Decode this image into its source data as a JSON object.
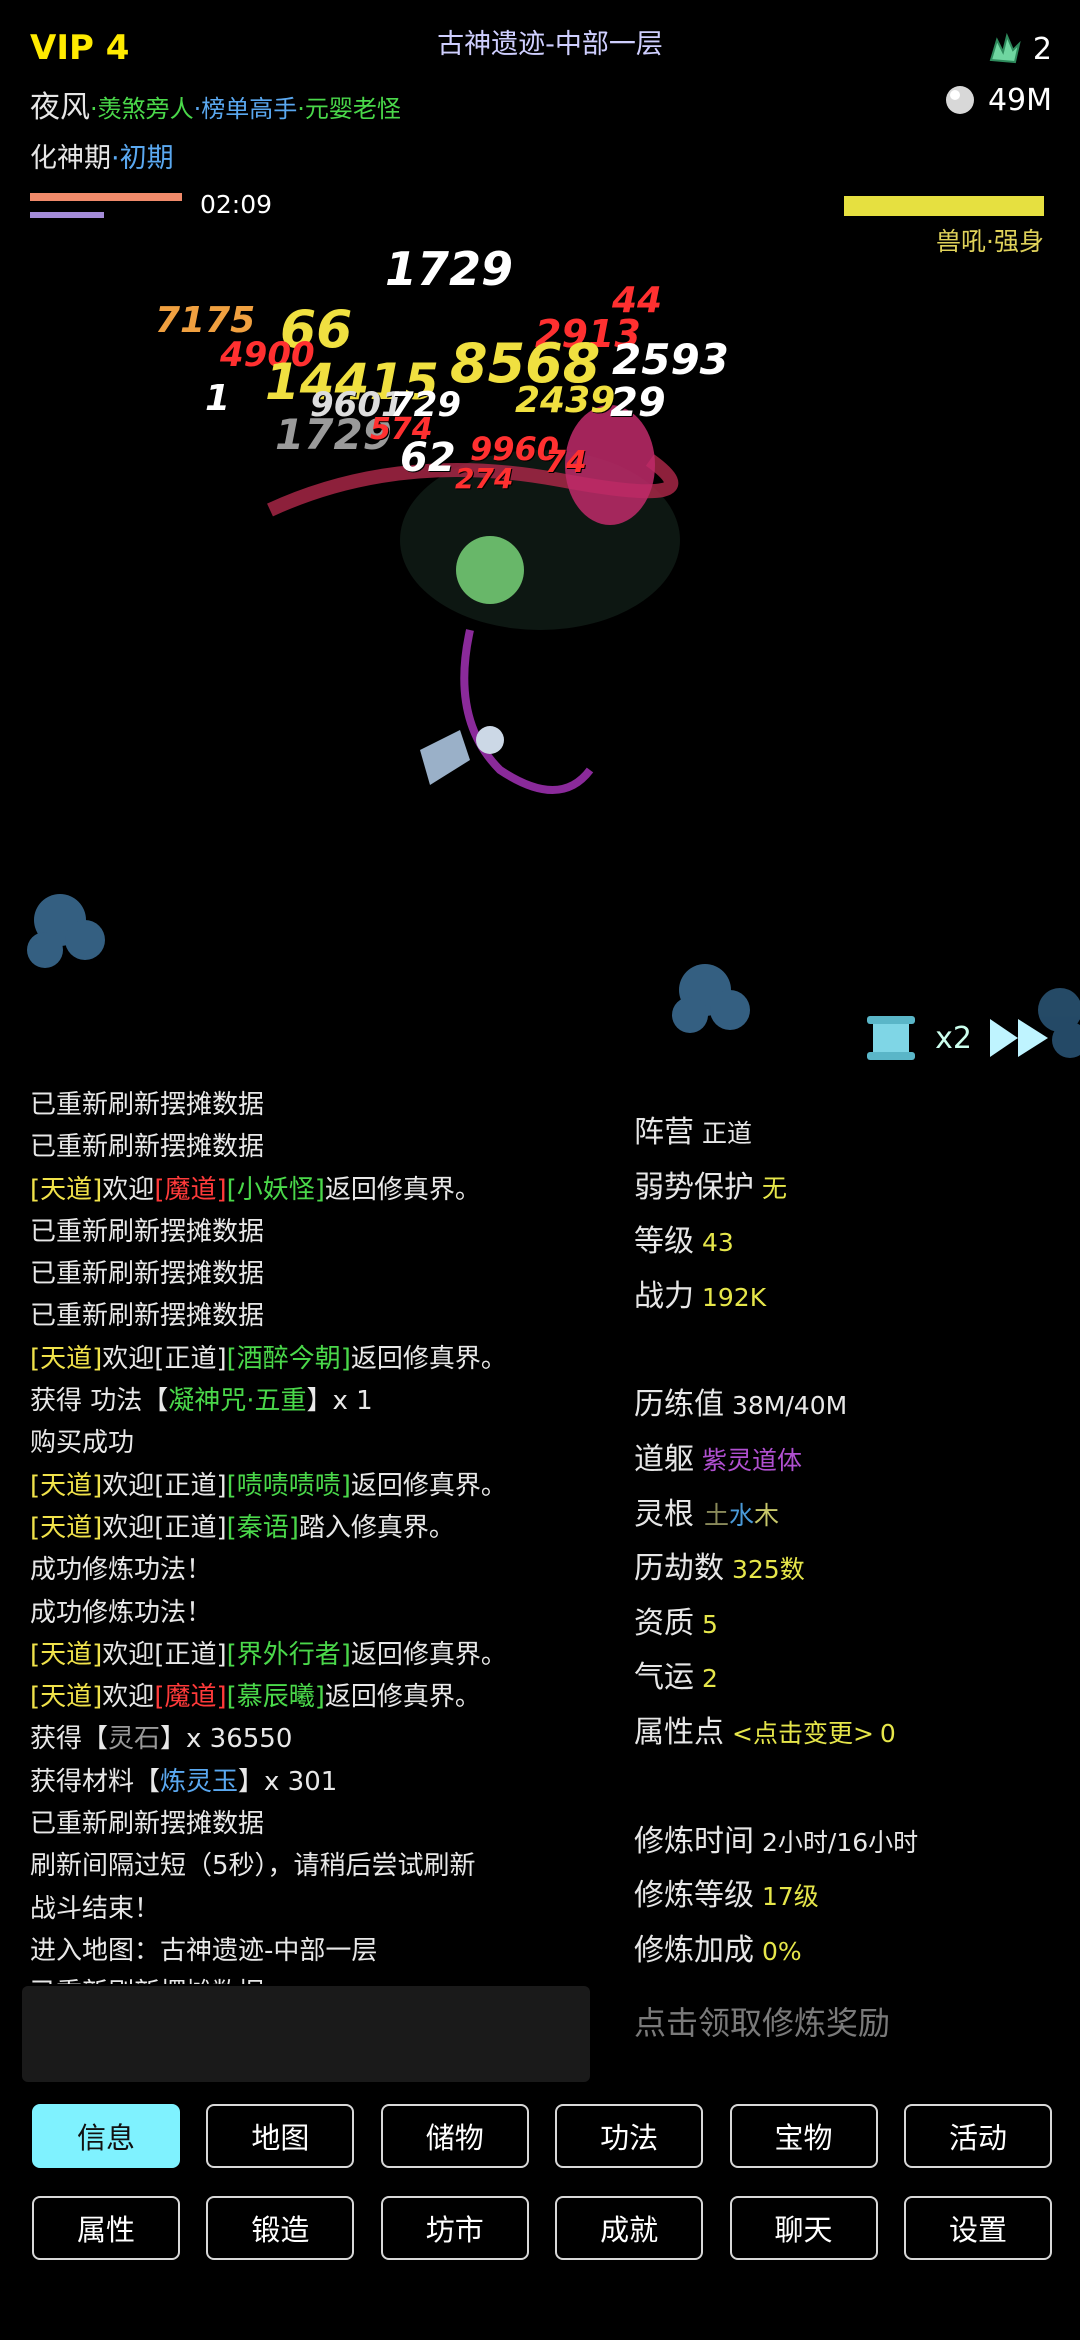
{
  "header": {
    "vip": "VIP 4",
    "map_title": "古神遗迹-中部一层",
    "gems": "2",
    "silver": "49M",
    "player_name": "夜风",
    "titles": [
      "·羡煞旁人",
      "·榜单高手",
      "·元婴老怪"
    ],
    "realm": "化神期",
    "realm_stage": "·初期",
    "timer": "02:09",
    "enemy_name": "兽吼·强身",
    "speed": "x2"
  },
  "damage_numbers": [
    "1729",
    "44",
    "7175",
    "66",
    "2913",
    "4900",
    "8568",
    "2593",
    "14415",
    "1",
    "9601",
    "729",
    "2439",
    "29",
    "1729",
    "574",
    "9960",
    "62",
    "274",
    "74"
  ],
  "log": [
    {
      "parts": [
        {
          "t": "已重新刷新摆摊数据"
        }
      ]
    },
    {
      "parts": [
        {
          "t": "已重新刷新摆摊数据"
        }
      ]
    },
    {
      "parts": [
        {
          "t": "[天道]",
          "c": "tian"
        },
        {
          "t": "欢迎"
        },
        {
          "t": "[魔道]",
          "c": "mo"
        },
        {
          "t": "[小妖怪]",
          "c": "name"
        },
        {
          "t": "返回修真界。"
        }
      ]
    },
    {
      "parts": [
        {
          "t": "已重新刷新摆摊数据"
        }
      ]
    },
    {
      "parts": [
        {
          "t": "已重新刷新摆摊数据"
        }
      ]
    },
    {
      "parts": [
        {
          "t": "已重新刷新摆摊数据"
        }
      ]
    },
    {
      "parts": [
        {
          "t": "[天道]",
          "c": "tian"
        },
        {
          "t": "欢迎[正道]"
        },
        {
          "t": "[酒醉今朝]",
          "c": "name"
        },
        {
          "t": "返回修真界。"
        }
      ]
    },
    {
      "parts": [
        {
          "t": "获得 功法【"
        },
        {
          "t": "凝神咒·五重",
          "c": "name"
        },
        {
          "t": "】x 1"
        }
      ]
    },
    {
      "parts": [
        {
          "t": "购买成功"
        }
      ]
    },
    {
      "parts": [
        {
          "t": "[天道]",
          "c": "tian"
        },
        {
          "t": "欢迎[正道]"
        },
        {
          "t": "[啧啧啧啧]",
          "c": "name"
        },
        {
          "t": "返回修真界。"
        }
      ]
    },
    {
      "parts": [
        {
          "t": "[天道]",
          "c": "tian"
        },
        {
          "t": "欢迎[正道]"
        },
        {
          "t": "[秦语]",
          "c": "name"
        },
        {
          "t": "踏入修真界。"
        }
      ]
    },
    {
      "parts": [
        {
          "t": "成功修炼功法！"
        }
      ]
    },
    {
      "parts": [
        {
          "t": "成功修炼功法！"
        }
      ]
    },
    {
      "parts": [
        {
          "t": "[天道]",
          "c": "tian"
        },
        {
          "t": "欢迎[正道]"
        },
        {
          "t": "[界外行者]",
          "c": "name"
        },
        {
          "t": "返回修真界。"
        }
      ]
    },
    {
      "parts": [
        {
          "t": "[天道]",
          "c": "tian"
        },
        {
          "t": "欢迎"
        },
        {
          "t": "[魔道]",
          "c": "mo"
        },
        {
          "t": "[慕辰曦]",
          "c": "name"
        },
        {
          "t": "返回修真界。"
        }
      ]
    },
    {
      "parts": [
        {
          "t": "获得【"
        },
        {
          "t": "灵石",
          "c": "grey"
        },
        {
          "t": "】x 36550"
        }
      ]
    },
    {
      "parts": [
        {
          "t": "获得材料【"
        },
        {
          "t": "炼灵玉",
          "c": "blue"
        },
        {
          "t": "】x 301"
        }
      ]
    },
    {
      "parts": [
        {
          "t": "已重新刷新摆摊数据"
        }
      ]
    },
    {
      "parts": [
        {
          "t": "刷新间隔过短（5秒），请稍后尝试刷新"
        }
      ]
    },
    {
      "parts": [
        {
          "t": "战斗结束！"
        }
      ]
    },
    {
      "parts": [
        {
          "t": "进入地图：古神遗迹-中部一层"
        }
      ]
    },
    {
      "parts": [
        {
          "t": "已重新刷新摆摊数据"
        }
      ]
    }
  ],
  "stats": {
    "faction_label": "阵营",
    "faction": "正道",
    "protect_label": "弱势保护",
    "protect": "无",
    "level_label": "等级",
    "level": "43",
    "power_label": "战力",
    "power": "192K",
    "exp_label": "历练值",
    "exp": "38M/40M",
    "body_label": "道躯",
    "body": "紫灵道体",
    "root_label": "灵根",
    "root_earth": "土",
    "root_water": "水",
    "root_wood": "木",
    "tribulation_label": "历劫数",
    "tribulation": "325数",
    "aptitude_label": "资质",
    "aptitude": "5",
    "luck_label": "气运",
    "luck": "2",
    "attr_label": "属性点",
    "attr_action": "<点击变更>",
    "attr": "0",
    "train_time_label": "修炼时间",
    "train_time": "2小时/16小时",
    "train_level_label": "修炼等级",
    "train_level": "17级",
    "train_bonus_label": "修炼加成",
    "train_bonus": "0%",
    "claim": "点击领取修炼奖励"
  },
  "buttons_row1": [
    "信息",
    "地图",
    "储物",
    "功法",
    "宝物",
    "活动"
  ],
  "buttons_row2": [
    "属性",
    "锻造",
    "坊市",
    "成就",
    "聊天",
    "设置"
  ],
  "active_button": "信息",
  "colors": {
    "accent": "#7ff2ff",
    "vip": "#ffea00",
    "hp": "#f08a6a",
    "enemy_hp": "#e6e040"
  }
}
